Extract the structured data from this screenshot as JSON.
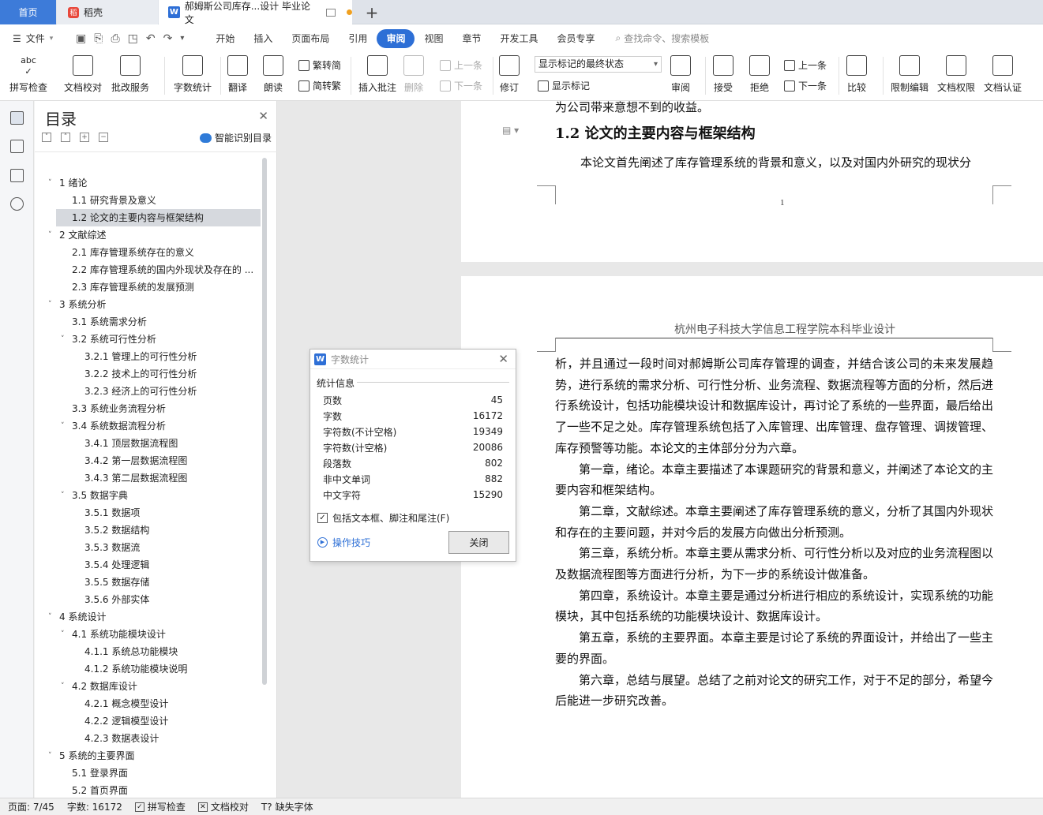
{
  "tabs": {
    "home": "首页",
    "daoke": "稻壳",
    "doc": "郝姆斯公司库存...设计 毕业论文",
    "plus": "+"
  },
  "menubar": {
    "file": "文件",
    "tabs": [
      "开始",
      "插入",
      "页面布局",
      "引用",
      "审阅",
      "视图",
      "章节",
      "开发工具",
      "会员专享"
    ],
    "active": "审阅",
    "search": "查找命令、搜索模板"
  },
  "ribbon": {
    "spellcheck": "拼写检查",
    "proofread": "文档校对",
    "annotate_service": "批改服务",
    "wordcount": "字数统计",
    "translate": "翻译",
    "read_aloud": "朗读",
    "to_traditional": "繁转简",
    "to_simplified": "简转繁",
    "insert_comment": "插入批注",
    "delete": "删除",
    "prev_comment": "上一条",
    "next_comment": "下一条",
    "revise": "修订",
    "markup_state": "显示标记的最终状态",
    "show_markup": "显示标记",
    "review": "审阅",
    "accept": "接受",
    "reject": "拒绝",
    "prev_change": "上一条",
    "next_change": "下一条",
    "compare": "比较",
    "restrict_edit": "限制编辑",
    "doc_permission": "文档权限",
    "doc_auth": "文档认证"
  },
  "toc": {
    "title": "目录",
    "smart": "智能识别目录",
    "items": [
      {
        "label": "1 绪论",
        "level": 1,
        "expand": true
      },
      {
        "label": "1.1 研究背景及意义",
        "level": 2
      },
      {
        "label": "1.2 论文的主要内容与框架结构",
        "level": 2,
        "selected": true
      },
      {
        "label": "2 文献综述",
        "level": 1,
        "expand": true
      },
      {
        "label": "2.1 库存管理系统存在的意义",
        "level": 2
      },
      {
        "label": "2.2 库存管理系统的国内外现状及存在的 ...",
        "level": 2
      },
      {
        "label": "2.3 库存管理系统的发展预测",
        "level": 2
      },
      {
        "label": "3 系统分析",
        "level": 1,
        "expand": true
      },
      {
        "label": "3.1 系统需求分析",
        "level": 2
      },
      {
        "label": "3.2 系统可行性分析",
        "level": 2,
        "expand": true
      },
      {
        "label": "3.2.1 管理上的可行性分析",
        "level": 3
      },
      {
        "label": "3.2.2 技术上的可行性分析",
        "level": 3
      },
      {
        "label": "3.2.3 经济上的可行性分析",
        "level": 3
      },
      {
        "label": "3.3 系统业务流程分析",
        "level": 2
      },
      {
        "label": "3.4 系统数据流程分析",
        "level": 2,
        "expand": true
      },
      {
        "label": "3.4.1 顶层数据流程图",
        "level": 3
      },
      {
        "label": "3.4.2 第一层数据流程图",
        "level": 3
      },
      {
        "label": "3.4.3 第二层数据流程图",
        "level": 3
      },
      {
        "label": "3.5 数据字典",
        "level": 2,
        "expand": true
      },
      {
        "label": "3.5.1 数据项",
        "level": 3
      },
      {
        "label": "3.5.2 数据结构",
        "level": 3
      },
      {
        "label": "3.5.3 数据流",
        "level": 3
      },
      {
        "label": "3.5.4 处理逻辑",
        "level": 3
      },
      {
        "label": "3.5.5 数据存储",
        "level": 3
      },
      {
        "label": "3.5.6 外部实体",
        "level": 3
      },
      {
        "label": "4 系统设计",
        "level": 1,
        "expand": true
      },
      {
        "label": "4.1 系统功能模块设计",
        "level": 2,
        "expand": true
      },
      {
        "label": "4.1.1 系统总功能模块",
        "level": 3
      },
      {
        "label": "4.1.2 系统功能模块说明",
        "level": 3
      },
      {
        "label": "4.2 数据库设计",
        "level": 2,
        "expand": true
      },
      {
        "label": "4.2.1 概念模型设计",
        "level": 3
      },
      {
        "label": "4.2.2 逻辑模型设计",
        "level": 3
      },
      {
        "label": "4.2.3 数据表设计",
        "level": 3
      },
      {
        "label": "5 系统的主要界面",
        "level": 1,
        "expand": true
      },
      {
        "label": "5.1 登录界面",
        "level": 2
      },
      {
        "label": "5.2 首页界面",
        "level": 2
      }
    ]
  },
  "document": {
    "cut_line": "为公司带来意想不到的收益。",
    "heading": "1.2 论文的主要内容与框架结构",
    "intro_line": "本论文首先阐述了库存管理系统的背景和意义，以及对国内外研究的现状分",
    "page_number": "1",
    "header": "杭州电子科技大学信息工程学院本科毕业设计",
    "paragraphs": [
      {
        "text": "析，并且通过一段时间对郝姆斯公司库存管理的调查，并结合该公司的未来发展趋势，进行系统的需求分析、可行性分析、业务流程、数据流程等方面的分析，然后进行系统设计，包括功能模块设计和数据库设计，再讨论了系统的一些界面，最后给出了一些不足之处。库存管理系统包括了入库管理、出库管理、盘存管理、调拨管理、库存预警等功能。本论文的主体部分分为六章。",
        "indent": false
      },
      {
        "text": "第一章，绪论。本章主要描述了本课题研究的背景和意义，并阐述了本论文的主要内容和框架结构。",
        "indent": true
      },
      {
        "text": "第二章，文献综述。本章主要阐述了库存管理系统的意义，分析了其国内外现状和存在的主要问题，并对今后的发展方向做出分析预测。",
        "indent": true
      },
      {
        "text": "第三章，系统分析。本章主要从需求分析、可行性分析以及对应的业务流程图以及数据流程图等方面进行分析，为下一步的系统设计做准备。",
        "indent": true
      },
      {
        "text": "第四章，系统设计。本章主要是通过分析进行相应的系统设计，实现系统的功能模块，其中包括系统的功能模块设计、数据库设计。",
        "indent": true
      },
      {
        "text": "第五章，系统的主要界面。本章主要是讨论了系统的界面设计，并给出了一些主要的界面。",
        "indent": true
      },
      {
        "text": "第六章，总结与展望。总结了之前对论文的研究工作，对于不足的部分，希望今后能进一步研究改善。",
        "indent": true
      }
    ]
  },
  "dialog": {
    "title": "字数统计",
    "group": "统计信息",
    "rows": [
      {
        "label": "页数",
        "value": "45"
      },
      {
        "label": "字数",
        "value": "16172"
      },
      {
        "label": "字符数(不计空格)",
        "value": "19349"
      },
      {
        "label": "字符数(计空格)",
        "value": "20086"
      },
      {
        "label": "段落数",
        "value": "802"
      },
      {
        "label": "非中文单词",
        "value": "882"
      },
      {
        "label": "中文字符",
        "value": "15290"
      }
    ],
    "include_label": "包括文本框、脚注和尾注(F)",
    "include_checked": true,
    "tips": "操作技巧",
    "close": "关闭"
  },
  "status": {
    "page": "页面: 7/45",
    "words": "字数: 16172",
    "spell": "拼写检查",
    "proof": "文档校对",
    "missing_font": "缺失字体"
  }
}
